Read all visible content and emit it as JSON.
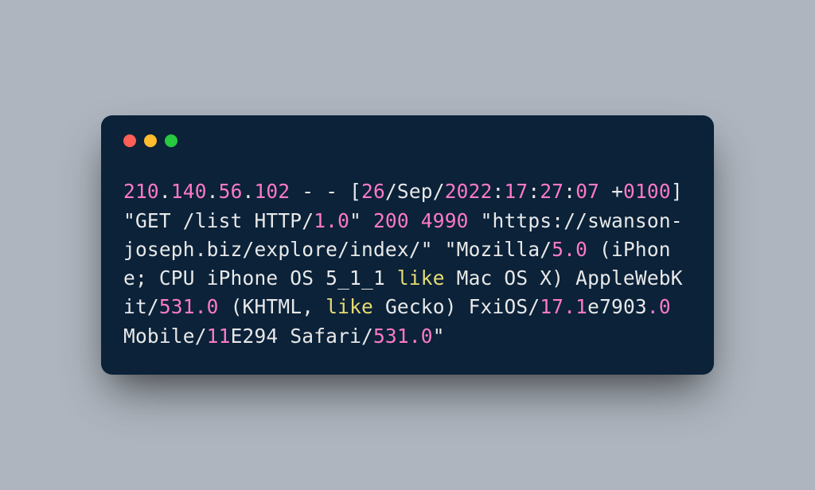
{
  "log_entry": {
    "ip_octets": [
      "210",
      "140",
      "56",
      "102"
    ],
    "sep_dash": " - - [",
    "date_day": "26",
    "date_month": "Sep",
    "date_year": "2022",
    "time_h": "17",
    "time_m": "27",
    "time_s": "07",
    "tz": "0100",
    "after_tz": "] \"GET /list HTTP/",
    "http_version": "1.0",
    "status_prefix": "\" ",
    "status_code": "200",
    "bytes": "4990",
    "referrer": "\"https://swanson-joseph.biz/explore/index/\"",
    "ua_prefix": "\"Mozilla/",
    "ua_moz_ver": "5.0",
    "ua_mid1": " (iPhone; CPU iPhone OS 5_1_1 ",
    "like1": "like",
    "ua_mid2": " Mac OS X) AppleWebKit/",
    "webkit_ver": "531.0",
    "ua_mid3": " (KHTML, ",
    "like2": "like",
    "ua_mid4": " Gecko) FxiOS/",
    "fxios_a": "17.1",
    "fxios_mid": "e7903",
    "fxios_b": ".0",
    "ua_mid5": " Mobile/",
    "mobile_build": "11",
    "mobile_build2": "E294 Safari/",
    "safari_ver": "531.0",
    "ua_suffix": "\""
  },
  "punct": {
    "dot": ".",
    "slash": "/",
    "colon": ":",
    "plus": "+",
    "space": " "
  }
}
